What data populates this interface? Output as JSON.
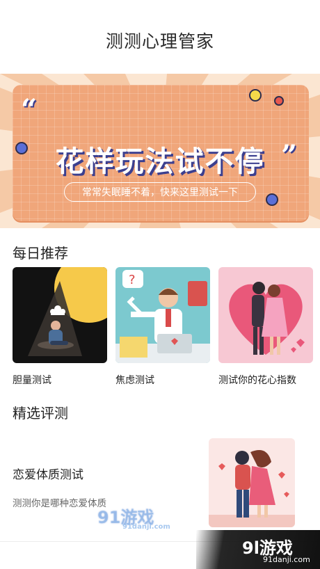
{
  "header": {
    "title": "测测心理管家"
  },
  "banner": {
    "quote_open": "“",
    "quote_close": "”",
    "title": "花样玩法试不停",
    "subtitle": "常常失眠睡不着，快来这里测试一下",
    "colors": {
      "bg": "#fbe6d2",
      "board": "#f0a67a",
      "shadow": "#3b3f8f"
    }
  },
  "recommend": {
    "title": "每日推荐",
    "cards": [
      {
        "label": "胆量测试",
        "icon": "person-under-spotlight-illustration"
      },
      {
        "label": "焦虑测试",
        "icon": "stressed-office-worker-illustration"
      },
      {
        "label": "测试你的花心指数",
        "icon": "couple-heart-illustration"
      }
    ]
  },
  "featured": {
    "title": "精选评测",
    "item": {
      "title": "恋爱体质测试",
      "desc": "测测你是哪种恋爱体质",
      "icon": "dancing-couple-illustration"
    }
  },
  "watermark": {
    "center_logo": "91游戏",
    "center_url": "91danji.com",
    "corner_logo": "9l游戏",
    "corner_url": "91danji.com"
  }
}
